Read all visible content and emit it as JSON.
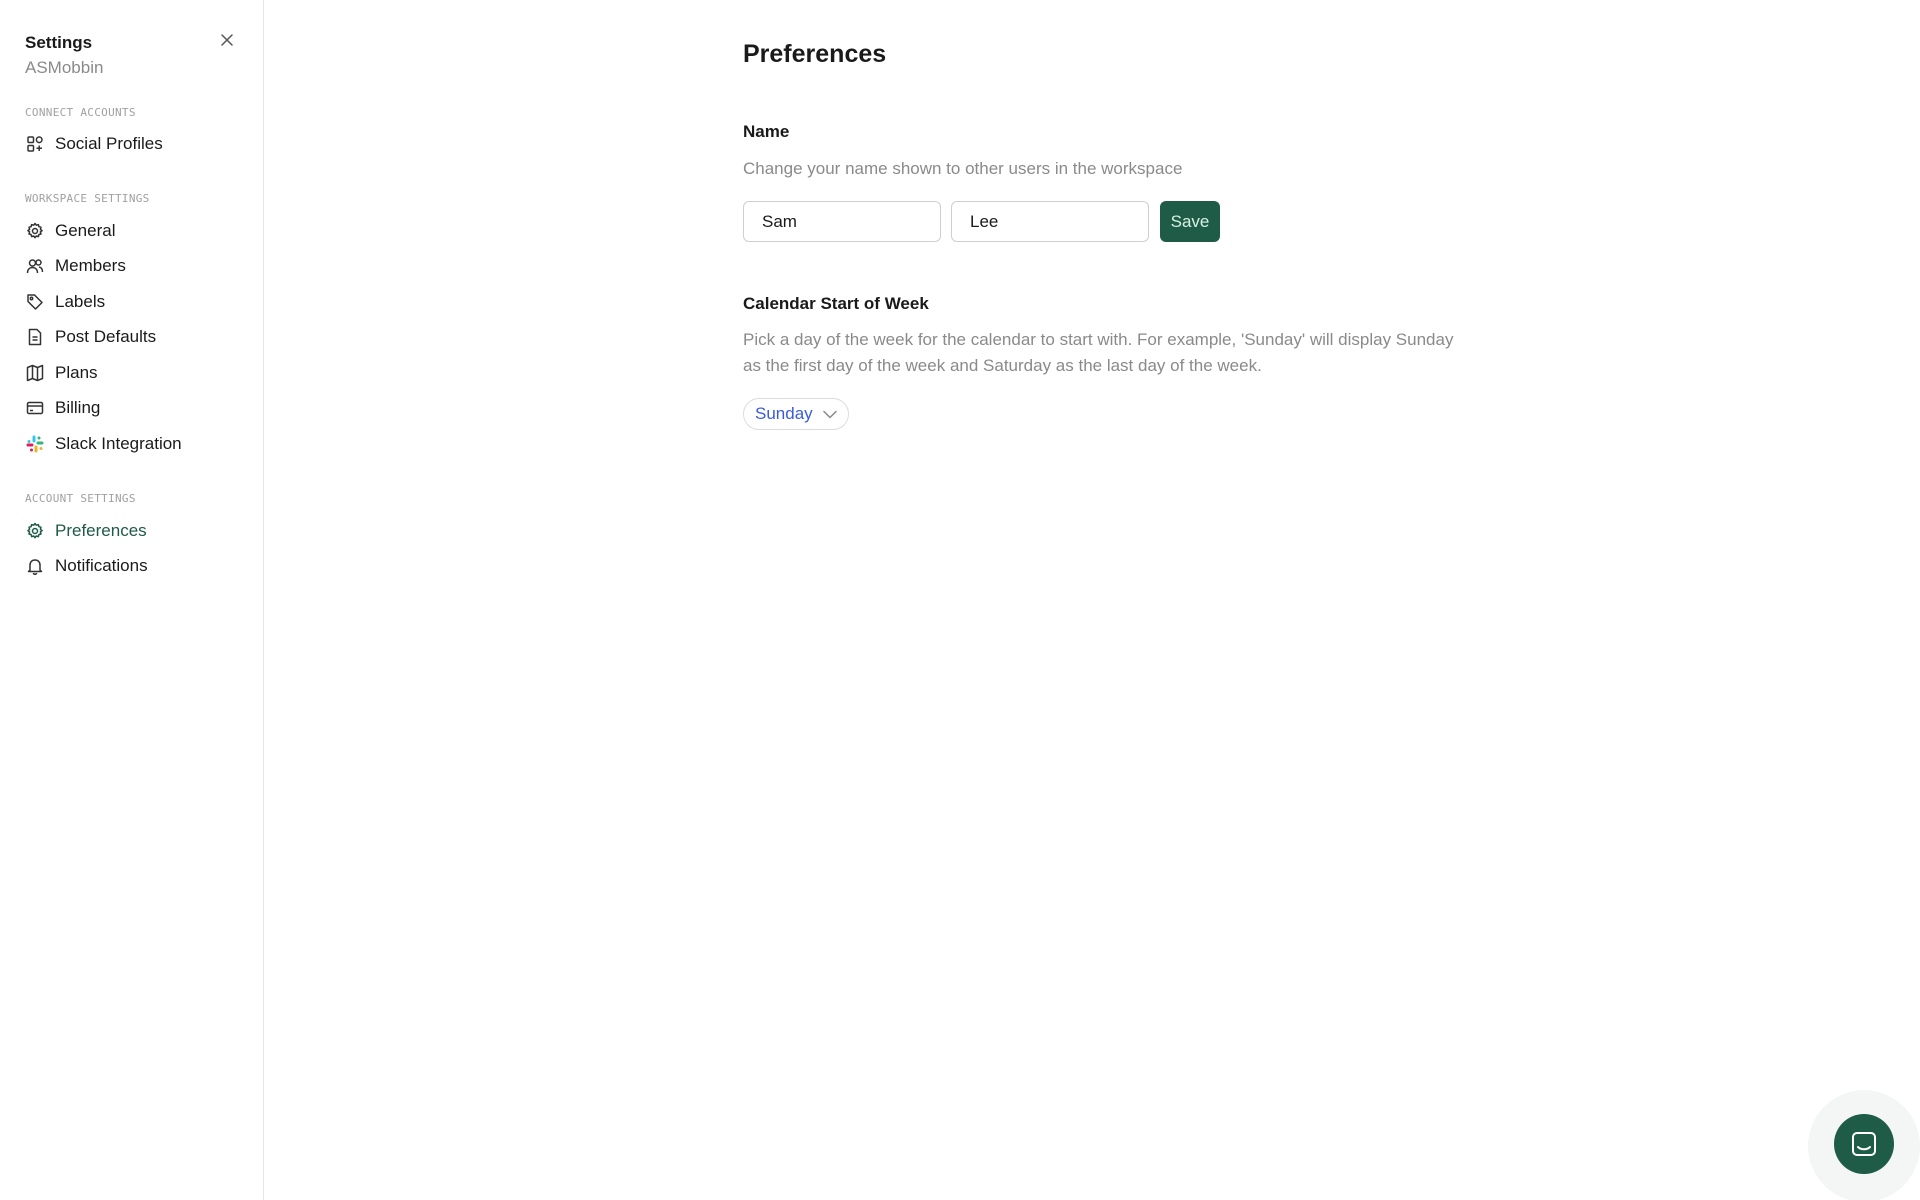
{
  "sidebar": {
    "title": "Settings",
    "workspace": "ASMobbin",
    "sections": {
      "connect": "CONNECT ACCOUNTS",
      "workspace": "WORKSPACE SETTINGS",
      "account": "ACCOUNT SETTINGS"
    },
    "items": [
      {
        "label": "Social Profiles",
        "icon": "grid-plus-icon"
      },
      {
        "label": "General",
        "icon": "gear-icon"
      },
      {
        "label": "Members",
        "icon": "users-icon"
      },
      {
        "label": "Labels",
        "icon": "tag-icon"
      },
      {
        "label": "Post Defaults",
        "icon": "document-icon"
      },
      {
        "label": "Plans",
        "icon": "map-icon"
      },
      {
        "label": "Billing",
        "icon": "credit-card-icon"
      },
      {
        "label": "Slack Integration",
        "icon": "slack-icon"
      },
      {
        "label": "Preferences",
        "icon": "gear-icon",
        "active": true
      },
      {
        "label": "Notifications",
        "icon": "bell-icon"
      }
    ]
  },
  "main": {
    "title": "Preferences",
    "name_section": {
      "title": "Name",
      "description": "Change your name shown to other users in the workspace",
      "first_name": "Sam",
      "last_name": "Lee",
      "save_label": "Save"
    },
    "calendar_section": {
      "title": "Calendar Start of Week",
      "description": "Pick a day of the week for the calendar to start with. For example, 'Sunday' will display Sunday as the first day of the week and Saturday as the last day of the week.",
      "selected_day": "Sunday"
    }
  },
  "colors": {
    "accent": "#1f5c48",
    "link": "#3b5bd9",
    "muted": "#8a8a8a"
  }
}
